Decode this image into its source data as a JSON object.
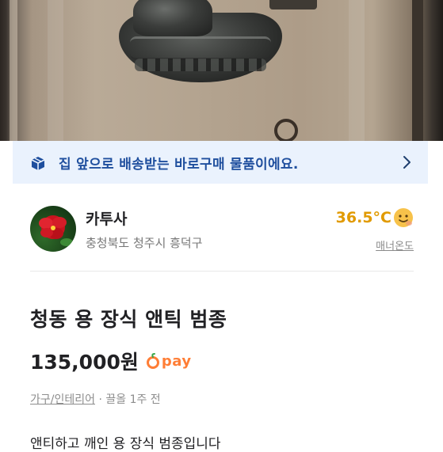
{
  "banner": {
    "text": "집 앞으로 배송받는 바로구매 물품이에요."
  },
  "seller": {
    "name": "카투사",
    "location": "충청북도 청주시 흥덕구",
    "temperature": "36.5°C",
    "manner_label": "매너온도"
  },
  "product": {
    "title": "청동 용 장식 앤틱 범종",
    "price": "135,000원",
    "pay_label": "pay",
    "category": "가구/인테리어",
    "meta_sep": " · ",
    "time": "끌올 1주 전",
    "description": "앤티하고 깨인 용 장식 범종입니다"
  },
  "colors": {
    "banner_bg": "#eaf2fd",
    "banner_text": "#1f4f9e",
    "temperature": "#e19a00",
    "pay_accent": "#ff7e36"
  },
  "icons": {
    "banner_left": "delivery-box-icon",
    "banner_right": "chevron-right-icon",
    "temperature": "smiley-face-icon",
    "pay": "orange-pay-icon"
  }
}
